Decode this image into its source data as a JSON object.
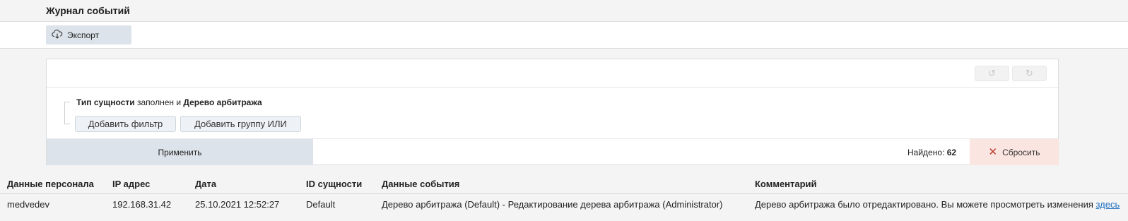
{
  "header": {
    "title": "Журнал событий"
  },
  "toolbar": {
    "export_label": "Экспорт",
    "export_icon": "cloud-download-icon"
  },
  "filter": {
    "undo_icon": "undo-icon",
    "redo_icon": "redo-icon",
    "condition": {
      "field1": "Тип сущности",
      "operator": "заполнен и",
      "field2": "Дерево арбитража"
    },
    "add_filter_label": "Добавить фильтр",
    "add_group_label": "Добавить группу ИЛИ",
    "apply_label": "Применить",
    "found_label": "Найдено:",
    "found_count": "62",
    "reset_label": "Сбросить"
  },
  "table": {
    "columns": [
      "Данные персонала",
      "IP адрес",
      "Дата",
      "ID сущности",
      "Данные события",
      "Комментарий"
    ],
    "rows": [
      {
        "user": "medvedev",
        "ip": "192.168.31.42",
        "date": "25.10.2021 12:52:27",
        "entity_id": "Default",
        "event": "Дерево арбитража (Default) - Редактирование дерева арбитража (Administrator)",
        "comment": "Дерево арбитража было отредактировано. Вы можете просмотреть изменения",
        "comment_link": "здесь"
      }
    ]
  }
}
